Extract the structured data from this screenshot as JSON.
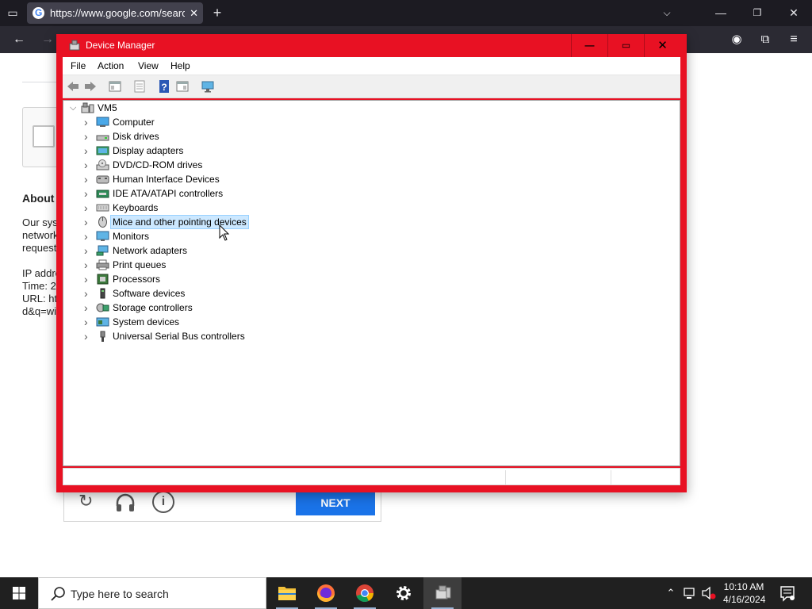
{
  "browser": {
    "tab_title": "https://www.google.com/search",
    "tab_close": "✕",
    "new_tab": "+",
    "favicon_letter": "G"
  },
  "page": {
    "about_heading": "About t",
    "lines": [
      "Our sys",
      "network",
      "request"
    ],
    "meta_lines": [
      "IP addre",
      "Time: 2",
      "URL: ht",
      "d&q=wi"
    ],
    "next_button": "NEXT"
  },
  "device_manager": {
    "title": "Device Manager",
    "menu": [
      "File",
      "Action",
      "View",
      "Help"
    ],
    "root": "VM5",
    "categories": [
      {
        "label": "Computer",
        "icon": "computer-icon"
      },
      {
        "label": "Disk drives",
        "icon": "disk-drive-icon"
      },
      {
        "label": "Display adapters",
        "icon": "display-adapter-icon"
      },
      {
        "label": "DVD/CD-ROM drives",
        "icon": "dvd-drive-icon"
      },
      {
        "label": "Human Interface Devices",
        "icon": "hid-icon"
      },
      {
        "label": "IDE ATA/ATAPI controllers",
        "icon": "ide-controller-icon"
      },
      {
        "label": "Keyboards",
        "icon": "keyboard-icon"
      },
      {
        "label": "Mice and other pointing devices",
        "icon": "mouse-icon",
        "selected": true
      },
      {
        "label": "Monitors",
        "icon": "monitor-icon"
      },
      {
        "label": "Network adapters",
        "icon": "network-adapter-icon"
      },
      {
        "label": "Print queues",
        "icon": "printer-icon"
      },
      {
        "label": "Processors",
        "icon": "processor-icon"
      },
      {
        "label": "Software devices",
        "icon": "software-device-icon"
      },
      {
        "label": "Storage controllers",
        "icon": "storage-controller-icon"
      },
      {
        "label": "System devices",
        "icon": "system-device-icon"
      },
      {
        "label": "Universal Serial Bus controllers",
        "icon": "usb-icon"
      }
    ]
  },
  "taskbar": {
    "search_placeholder": "Type here to search",
    "time": "10:10 AM",
    "date": "4/16/2024",
    "apps": [
      "file-explorer-icon",
      "firefox-icon",
      "chrome-icon",
      "settings-icon",
      "device-manager-icon"
    ]
  },
  "colors": {
    "window_accent": "#e81123",
    "selection": "#cce8ff",
    "next_button": "#1a73e8"
  }
}
